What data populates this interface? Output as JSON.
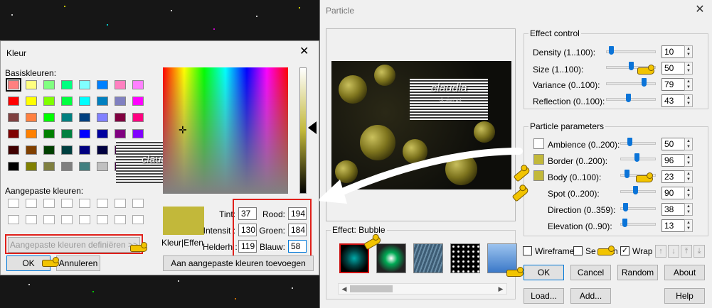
{
  "particle": {
    "title": "Particle",
    "close_glyph": "✕",
    "effect_control": {
      "title": "Effect control",
      "rows": [
        {
          "label": "Density (1..100):",
          "value": "10"
        },
        {
          "label": "Size (1..100):",
          "value": "50"
        },
        {
          "label": "Variance (0..100):",
          "value": "79"
        },
        {
          "label": "Reflection (0..100):",
          "value": "43"
        }
      ]
    },
    "particle_parameters": {
      "title": "Particle parameters",
      "rows": [
        {
          "label": "Ambience (0..200):",
          "value": "50",
          "swatch": "#ffffff"
        },
        {
          "label": "Border (0..200):",
          "value": "96",
          "swatch": "#c2b83a"
        },
        {
          "label": "Body (0..100):",
          "value": "23",
          "swatch": "#c2b83a"
        },
        {
          "label": "Spot (0..200):",
          "value": "90"
        },
        {
          "label": "Direction (0..359):",
          "value": "38"
        },
        {
          "label": "Elevation (0..90):",
          "value": "13"
        }
      ]
    },
    "effect": {
      "title": "Effect: Bubble",
      "thumbs": [
        "bubble",
        "sparkle",
        "rain",
        "snow",
        "cloud"
      ]
    },
    "options": {
      "wireframe": "Wireframe",
      "select": "Se",
      "select_suffix": "n",
      "wrap": "Wrap",
      "wrap_checked": "✓"
    },
    "nav_buttons": [
      "↑",
      "↓",
      "⤒",
      "⤓"
    ],
    "buttons": {
      "ok": "OK",
      "cancel": "Cancel",
      "random": "Random",
      "about": "About",
      "load": "Load...",
      "add": "Add...",
      "help": "Help"
    },
    "logo": {
      "text": "claudia",
      "sub": "design art"
    }
  },
  "kleur": {
    "title": "Kleur",
    "close_glyph": "✕",
    "basic_label": "Basiskleuren:",
    "basic_colors": [
      [
        "#ff8080",
        "#ffff80",
        "#80ff80",
        "#00ff80",
        "#80ffff",
        "#0080ff",
        "#ff80c0",
        "#ff80ff"
      ],
      [
        "#ff0000",
        "#ffff00",
        "#80ff00",
        "#00ff40",
        "#00ffff",
        "#0080c0",
        "#8080c0",
        "#ff00ff"
      ],
      [
        "#804040",
        "#ff8040",
        "#00ff00",
        "#008080",
        "#004080",
        "#8080ff",
        "#800040",
        "#ff0080"
      ],
      [
        "#800000",
        "#ff8000",
        "#008000",
        "#008040",
        "#0000ff",
        "#0000a0",
        "#800080",
        "#8000ff"
      ],
      [
        "#400000",
        "#804000",
        "#004000",
        "#004040",
        "#000080",
        "#000040",
        "#400040",
        "#400080"
      ],
      [
        "#000000",
        "#808000",
        "#808040",
        "#808080",
        "#408080",
        "#c0c0c0",
        "#400040",
        "#ffffff"
      ]
    ],
    "custom_label": "Aangepaste kleuren:",
    "define_button": "Aangepaste kleuren definiëren >>",
    "ok": "OK",
    "cancel": "Annuleren",
    "preview_label": "Kleur|Effen",
    "add_custom": "Aan aangepaste kleuren toevoegen",
    "fields": {
      "tint": {
        "label": "Tint:",
        "value": "37"
      },
      "intensity": {
        "label": "Intensit :",
        "value": "130"
      },
      "brightness": {
        "label": "Helderh :",
        "value": "119"
      },
      "red": {
        "label": "Rood:",
        "value": "194"
      },
      "green": {
        "label": "Groen:",
        "value": "184"
      },
      "blue": {
        "label": "Blauw:",
        "value": "58"
      }
    },
    "selected_color": "#c2b83a"
  }
}
